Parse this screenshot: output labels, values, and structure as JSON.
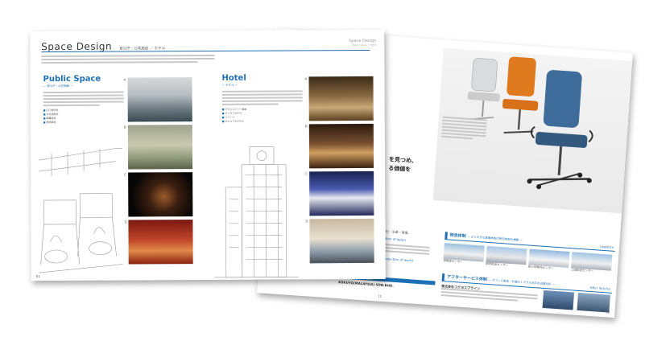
{
  "back_page": {
    "headline_1": "を見つめ、",
    "headline_2": "る価値を",
    "sec_japan": "uction of japan",
    "sec_world": "ntroduction of world",
    "nav_top": "会社・沿革・事業",
    "logistics": {
      "title": "物流体制",
      "subtitle": "— より大きな倉庫体制の物流体制を構築 —",
      "tag": "Logistics",
      "items": [
        "伊勢原センター",
        "関西配送センター",
        "柏ヶ崎物流センター",
        "三田配送センター"
      ]
    },
    "after_service": {
      "title": "アフターサービス体制",
      "subtitle": "— オフィス家具・什器のトラブル対応を迅速対応 —",
      "tag": "After Service",
      "company": "株式会社コクヨスプライン"
    },
    "world_company": "KOKUYO(MALAYSIA) SDN.BHD.",
    "world_caption": "国外ネットワーク体制",
    "page_no_left": "11",
    "page_no_right": "12"
  },
  "front_page": {
    "title": "Space Design",
    "title_sub": "官公庁・公共施設 ／ ホテル",
    "header_right": "Space Design",
    "header_right_sub": "Public Space · Hotel",
    "public_space": {
      "heading": "Public Space",
      "subheading": "— 官公庁・公共施設 —",
      "bullets": [
        "〇〇役所等",
        "文化施設等",
        "図書館等",
        "美術館等"
      ]
    },
    "hotel": {
      "heading": "Hotel",
      "subheading": "— ホテル —",
      "bullets": [
        "ラグジュアリー施設",
        "ビジネスホテル",
        "リゾート",
        "カジュアルホテル"
      ]
    },
    "photo_labels": [
      "A",
      "B",
      "C",
      "D",
      "A",
      "B",
      "C",
      "D"
    ],
    "page_no": "01"
  },
  "colors": {
    "accent": "#1d6fb5",
    "chair_orange": "#e07a1e",
    "chair_blue": "#3e6d9b"
  }
}
